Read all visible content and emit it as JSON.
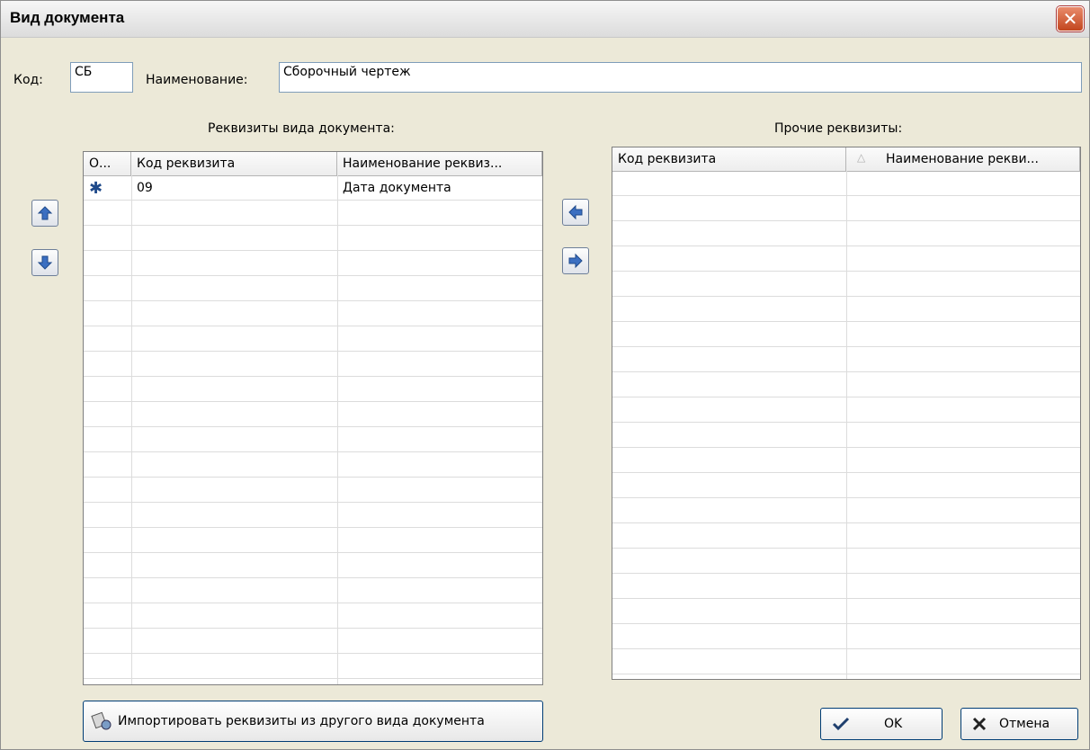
{
  "window": {
    "title": "Вид документа",
    "close_icon": "close-icon"
  },
  "fields": {
    "code_label": "Код:",
    "code_value": "СБ",
    "name_label": "Наименование:",
    "name_value": "Сборочный чертеж"
  },
  "left_panel": {
    "title": "Реквизиты вида документа:",
    "columns": [
      "О...",
      "Код реквизита",
      "Наименование реквиз..."
    ],
    "rows": [
      {
        "marker": "✱",
        "code": "09",
        "name": "Дата документа"
      }
    ]
  },
  "right_panel": {
    "title": "Прочие реквизиты:",
    "columns": [
      "Код реквизита",
      "Наименование рекви..."
    ],
    "rows": []
  },
  "buttons": {
    "import_label": "Импортировать реквизиты из другого вида документа",
    "ok_label": "OK",
    "cancel_label": "Отмена"
  },
  "colors": {
    "accent": "#2a5fa8",
    "arrow_fill": "#3b6fc1"
  }
}
